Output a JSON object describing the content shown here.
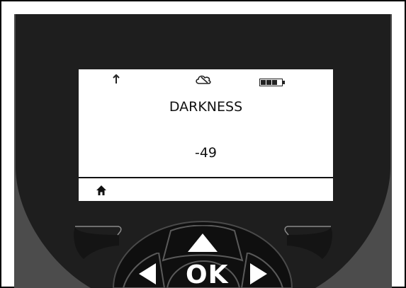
{
  "screen": {
    "status_icons": [
      "antenna-icon",
      "cloud-icon",
      "battery-icon"
    ],
    "title": "DARKNESS",
    "value": "-49",
    "nav_icon": "home-icon"
  },
  "keypad": {
    "ok_label": "OK",
    "keys": [
      "left-softkey-button",
      "up-arrow-button",
      "right-softkey-button",
      "left-arrow-button",
      "ok-button",
      "right-arrow-button"
    ]
  },
  "colors": {
    "bezel": "#1e1e1e",
    "bezel_edge": "#4c4c4c",
    "lcd": "#ffffff",
    "keypad": "#0f0f0f"
  }
}
